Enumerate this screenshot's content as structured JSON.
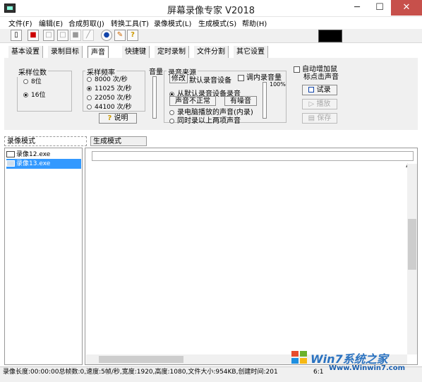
{
  "window": {
    "title": "屏幕录像专家 V2018"
  },
  "menu": [
    "文件(F)",
    "编辑(E)",
    "合成剪取(J)",
    "转换工具(T)",
    "录像模式(L)",
    "生成模式(S)",
    "帮助(H)"
  ],
  "toolbar": {
    "icons": [
      "new-file-icon",
      "record-icon",
      "stop-icon",
      "pause-icon",
      "camera-icon",
      "brush-icon",
      "globe-icon",
      "edit-file-icon",
      "help-icon"
    ],
    "help_glyph": "?"
  },
  "tabs": [
    {
      "label": "基本设置",
      "active": false
    },
    {
      "label": "录制目标",
      "active": false
    },
    {
      "label": "声音",
      "active": true
    },
    {
      "label": "快捷键",
      "active": false
    },
    {
      "label": "定时录制",
      "active": false
    },
    {
      "label": "文件分割",
      "active": false
    },
    {
      "label": "其它设置",
      "active": false
    }
  ],
  "sound": {
    "bits": {
      "title": "采样位数",
      "options": [
        "8位",
        "16位"
      ],
      "selected": 1
    },
    "rate": {
      "title": "采样频率",
      "options": [
        "8000 次/秒",
        "11025 次/秒",
        "22050 次/秒",
        "44100 次/秒"
      ],
      "selected": 1
    },
    "explain_button": "说明",
    "volume_label": "音量",
    "source": {
      "title": "录音来源",
      "modify_button": "修改",
      "default_device": "默认录音设备",
      "adjust_internal": "调内录音量",
      "percent": "100%",
      "options": [
        "从默认录音设备录音",
        "录电脑播放的声音(内录)",
        "同时录以上两项声音"
      ],
      "selected": 0,
      "abnormal_button": "声音不正常",
      "noise_button": "有噪音"
    },
    "auto_mouse": "自动增加鼠",
    "auto_mouse_2": "标点击声音",
    "test_button": "试录",
    "play_button": "播放",
    "save_button": "保存"
  },
  "lower_tabs": {
    "record_mode": "录像模式",
    "gen_mode": "生成模式"
  },
  "files": [
    {
      "name": "录像12.exe",
      "selected": false
    },
    {
      "name": "录像13.exe",
      "selected": true
    }
  ],
  "status": "录像长度:00:00:00总帧数:0,速度:5帧/秒,宽度:1920,高度:1080,文件大小:954KB,创建时间:201",
  "status_tail": "6:1",
  "watermark": {
    "brand": "Win7系统之家",
    "url": "Www.Winwin7.com"
  }
}
